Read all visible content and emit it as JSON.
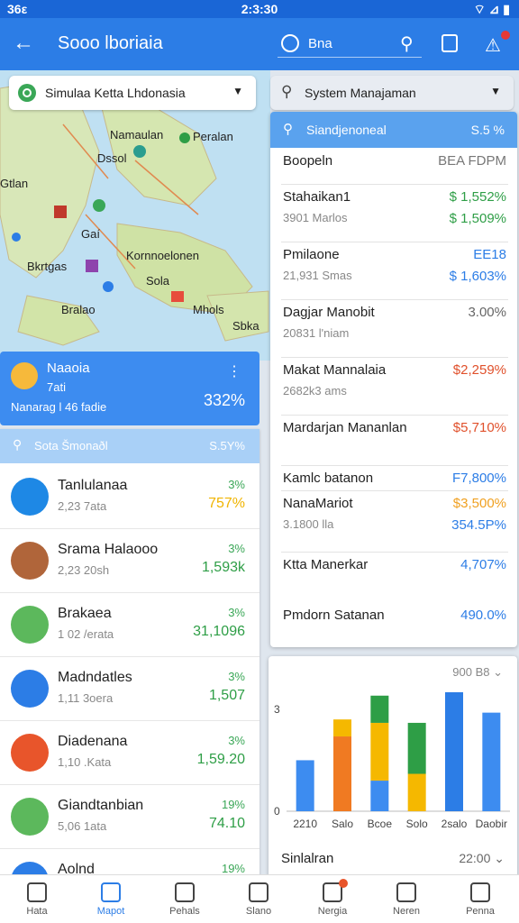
{
  "status": {
    "left": "36ε",
    "time": "2:3:30",
    "right": "⌔ ⊿ ▮"
  },
  "appbar": {
    "title": "Sooo lboriaia",
    "region_label": "Bna"
  },
  "map_search": {
    "text": "Simulaa Ketta Lhdonasia"
  },
  "map_labels": [
    "Namaulan",
    "Peralan",
    "Dssol",
    "Gtlan",
    "Gaí",
    "Kornnoelonen",
    "Sola",
    "Bkrtgas",
    "Mhols",
    "Sbka",
    "Bralao"
  ],
  "system_dropdown": {
    "text": "System Manajaman"
  },
  "right_panel": {
    "header_title": "Siandjenoneal",
    "header_value": "S.5 %",
    "rows": [
      {
        "name": "Boopeln",
        "sub": "",
        "v1": "BEA FDPM",
        "v2": "",
        "c1": "#777777",
        "c2": "#777777"
      },
      {
        "name": "Stahaikan1",
        "sub": "3901 Marlos",
        "v1": "$ 1,552%",
        "v2": "$ 1,509%",
        "c1": "#2e9e46",
        "c2": "#2e9e46"
      },
      {
        "name": "Pmilaone",
        "sub": "21,931 Smas",
        "v1": "EE18",
        "v2": "$ 1,603%",
        "c1": "#2c7de6",
        "c2": "#2c7de6"
      },
      {
        "name": "Dagjar Manobit",
        "sub": "20831 l'niam",
        "v1": "3.00%",
        "v2": "",
        "c1": "#666666",
        "c2": "#666666"
      },
      {
        "name": "Makat Mannalaia",
        "sub": "2682k3 ams",
        "v1": "$2,259%",
        "v2": "",
        "c1": "#e0502b",
        "c2": "#e0502b"
      },
      {
        "name": "Mardarjan Mananlan",
        "sub": "",
        "v1": "$5,710%",
        "v2": "",
        "c1": "#e0502b",
        "c2": "#e0502b"
      },
      {
        "name": "Kamlc batanon",
        "sub": "",
        "v1": "F7,800%",
        "v2": "",
        "c1": "#2c7de6",
        "c2": "#2c7de6"
      },
      {
        "name": "NanaMariot",
        "sub": "3.1800 lla",
        "v1": "$3,500%",
        "v2": "354.5P%",
        "c1": "#f0a020",
        "c2": "#2c7de6"
      },
      {
        "name": "Ktta Manerkar",
        "sub": "",
        "v1": "4,707%",
        "v2": "",
        "c1": "#2c7de6",
        "c2": "#2c7de6"
      },
      {
        "name": "Pmdorn Satanan",
        "sub": "",
        "v1": "490.0%",
        "v2": "",
        "c1": "#2c7de6",
        "c2": "#2c7de6"
      }
    ]
  },
  "highlight": {
    "title": "Naaoia",
    "sub1": "7ati",
    "sub2": "Nanarag l 46 fadie",
    "value": "332%"
  },
  "left_panel": {
    "header_title": "Sota Šmonaðl",
    "header_value": "S.5Y%",
    "rows": [
      {
        "name": "Tanlulanaa",
        "sub": "2,23 7ata",
        "pct": "3%",
        "val": "757%",
        "color": "#f0b400",
        "avatar": "#1e88e5"
      },
      {
        "name": "Srama Halaooo",
        "sub": "2,23 20sh",
        "pct": "3%",
        "val": "1,593k",
        "color": "#2e9e46",
        "avatar": "#b0653a"
      },
      {
        "name": "Brakaea",
        "sub": "1 02 /erata",
        "pct": "3%",
        "val": "31,1096",
        "color": "#2e9e46",
        "avatar": "#5cb85c"
      },
      {
        "name": "Madndatles",
        "sub": "1,11 3oera",
        "pct": "3%",
        "val": "1,507",
        "color": "#2e9e46",
        "avatar": "#2c7de6"
      },
      {
        "name": "Diadenana",
        "sub": "1,10 .Kata",
        "pct": "3%",
        "val": "1,59.20",
        "color": "#2e9e46",
        "avatar": "#e8552b"
      },
      {
        "name": "Giandtanbian",
        "sub": "5,06 1ata",
        "pct": "19%",
        "val": "74.10",
        "color": "#2e9e46",
        "avatar": "#5cb85c"
      },
      {
        "name": "Aolnd",
        "sub": "",
        "pct": "19%",
        "val": "",
        "color": "#2e9e46",
        "avatar": "#2c7de6"
      }
    ]
  },
  "chart_card": {
    "range": "900 B8 ⌄",
    "footer_label": "Sinlalran",
    "footer_value": "22:00 ⌄"
  },
  "chart_data": {
    "type": "bar",
    "categories": [
      "2210",
      "Salo",
      "Bcoe",
      "Solo",
      "2salo",
      "Daobir"
    ],
    "ylim": [
      0,
      3.5
    ],
    "yticks": [
      0,
      3
    ],
    "series": [
      {
        "values": [
          1.5,
          2.2,
          0.9,
          0,
          3.5,
          2.9
        ],
        "color": "#3d8cf0"
      },
      {
        "values": [
          0,
          0.5,
          1.7,
          1.1,
          0,
          0
        ],
        "color": "#f5b800"
      },
      {
        "values": [
          0,
          0,
          0.8,
          1.5,
          0,
          0
        ],
        "color": "#2e9e46"
      }
    ],
    "colors_per_category": [
      "#3d8cf0",
      "#f07a22",
      "#mixed",
      "#mixed",
      "#2c7de6",
      "#3d8cf0"
    ]
  },
  "bottom_nav": [
    {
      "label": "Hata",
      "active": false
    },
    {
      "label": "Mapot",
      "active": true
    },
    {
      "label": "Pehals",
      "active": false
    },
    {
      "label": "Slano",
      "active": false
    },
    {
      "label": "Nergia",
      "active": false
    },
    {
      "label": "Neren",
      "active": false
    },
    {
      "label": "Penna",
      "active": false
    }
  ]
}
